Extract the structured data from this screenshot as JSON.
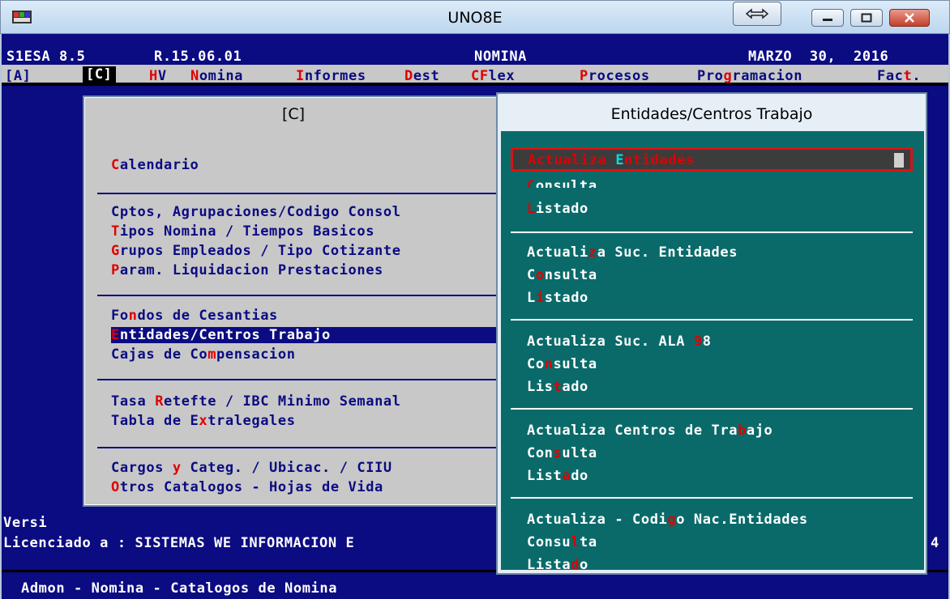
{
  "window": {
    "title": "UNO8E"
  },
  "header": {
    "product": "S1ESA 8.5",
    "release": "R.15.06.01",
    "module": "NOMINA",
    "date": "MARZO  30,  2016"
  },
  "menubar": {
    "items": [
      "[A]",
      "[C]",
      "HV",
      "Nomina",
      "Informes",
      "Dest",
      "CFlex",
      "Procesos",
      "Programacion",
      "Fact."
    ],
    "selected": "[C]"
  },
  "left_panel": {
    "title": "[C]",
    "groups": [
      [
        "Calendario"
      ],
      [
        "Cptos, Agrupaciones/Codigo Consol",
        "Tipos Nomina / Tiempos Basicos",
        "Grupos Empleados / Tipo Cotizante",
        "Param. Liquidacion Prestaciones"
      ],
      [
        "Fondos de Cesantias",
        "Entidades/Centros Trabajo",
        "Cajas de Compensacion"
      ],
      [
        "Tasa Retefte / IBC Minimo Semanal",
        "Tabla de Extralegales"
      ],
      [
        "Cargos y Categ. / Ubicac. / CIIU",
        "Otros Catalogos - Hojas de Vida"
      ]
    ],
    "selected": "Entidades/Centros Trabajo"
  },
  "right_panel": {
    "title": "Entidades/Centros Trabajo",
    "groups": [
      [
        "Actualiza Entidades",
        "Consulta",
        "Listado"
      ],
      [
        "Actualiza Suc. Entidades",
        "Consulta",
        "Listado"
      ],
      [
        "Actualiza Suc. ALA 98",
        "Consulta",
        "Listado"
      ],
      [
        "Actualiza Centros de Trabajo",
        "Consulta",
        "Listado"
      ],
      [
        "Actualiza - Codigo Nac.Entidades",
        "Consulta",
        "Listado"
      ]
    ],
    "selected": "Actualiza Entidades"
  },
  "background_text": {
    "version_fragment": "Versi",
    "license": "Licenciado a : SISTEMAS WE INFORMACION E",
    "license_tail": "4",
    "status": "Admon - Nomina - Catalogos de Nomina"
  },
  "colors": {
    "console_bg": "#0b0b82",
    "menu_bg": "#c8c8c8",
    "submenu_bg": "#0a6a6a",
    "hotkey": "#e00000",
    "highlight_border": "#dd1111"
  }
}
